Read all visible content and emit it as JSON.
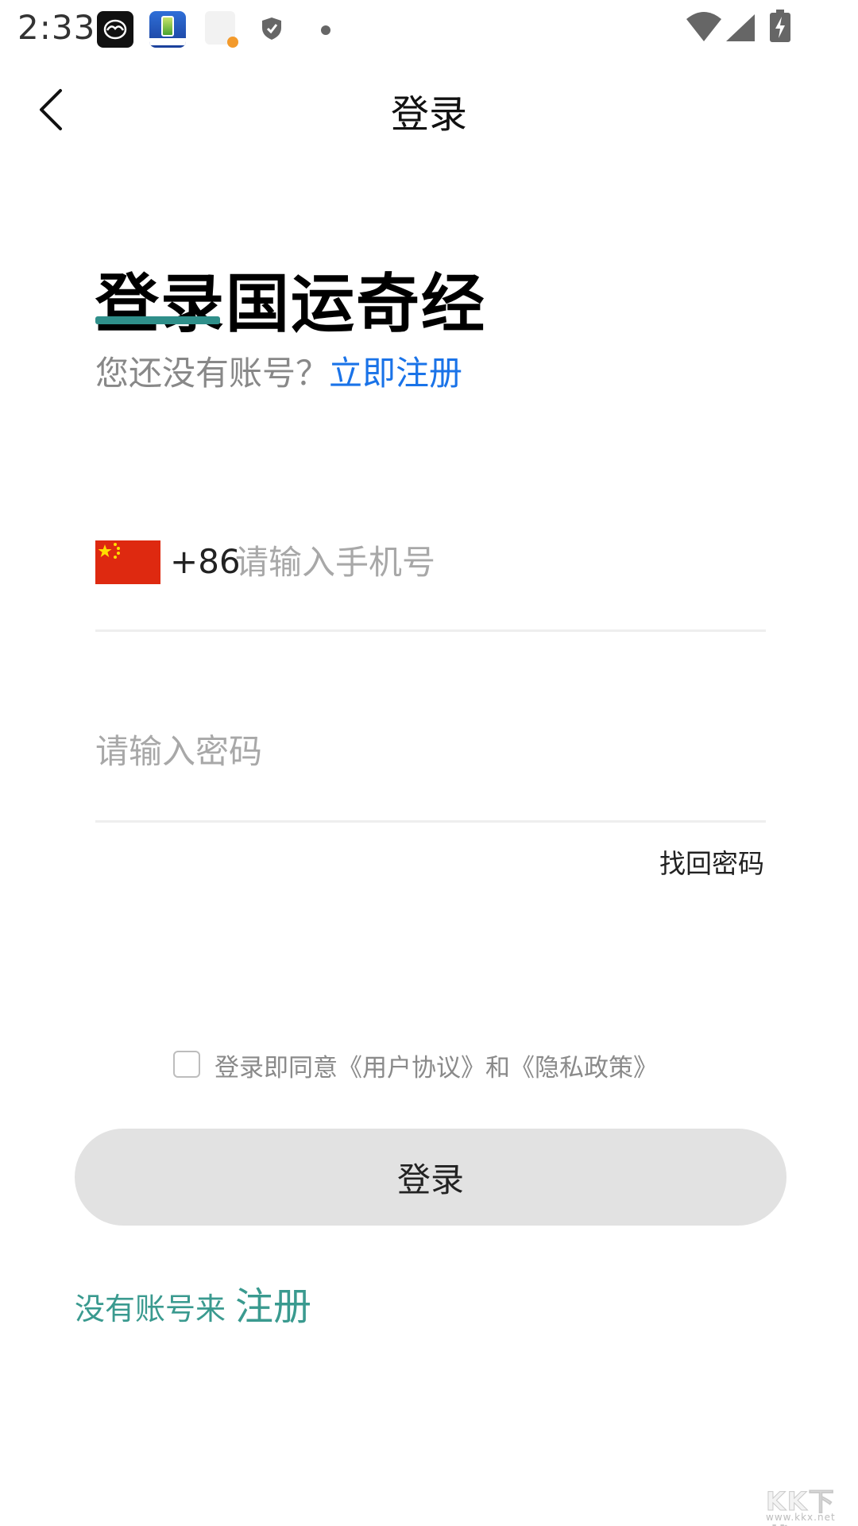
{
  "status_bar": {
    "time": "2:33",
    "icons": [
      "mazda-app-icon",
      "battery-app-icon",
      "file-app-icon",
      "shield-icon",
      "notification-dot-icon",
      "wifi-icon",
      "signal-icon",
      "battery-charging-icon"
    ]
  },
  "nav": {
    "back_icon": "chevron-left-icon",
    "title": "登录"
  },
  "header": {
    "headline": "登录国运奇经",
    "subline_text": "您还没有账号？",
    "subline_link": "立即注册"
  },
  "form": {
    "country_flag": "china-flag-icon",
    "country_code": "+86",
    "phone_placeholder": "请输入手机号",
    "phone_value": "",
    "password_placeholder": "请输入密码",
    "password_value": "",
    "forgot_password": "找回密码"
  },
  "agreement": {
    "checked": false,
    "text": "登录即同意《用户协议》和《隐私政策》"
  },
  "actions": {
    "login_label": "登录",
    "bottom_pre": "没有账号来",
    "bottom_link": "注册"
  },
  "watermark": {
    "logo_text": "KK下载",
    "url": "www.kkx.net"
  },
  "colors": {
    "accent_teal": "#2f8f8a",
    "link_blue": "#1a73e8",
    "button_bg": "#e2e2e2",
    "bottom_link": "#3a9a8f"
  }
}
